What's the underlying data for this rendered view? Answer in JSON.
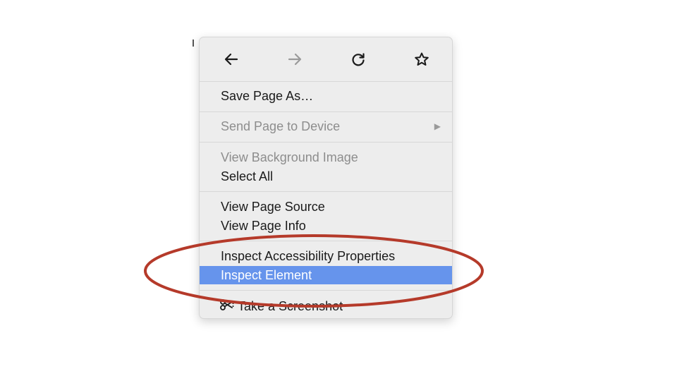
{
  "nav": {
    "back_icon": "arrow-left-icon",
    "forward_icon": "arrow-right-icon",
    "reload_icon": "reload-icon",
    "bookmark_icon": "star-icon"
  },
  "menu": {
    "save_page_as": "Save Page As…",
    "send_page_to_device": "Send Page to Device",
    "view_background_image": "View Background Image",
    "select_all": "Select All",
    "view_page_source": "View Page Source",
    "view_page_info": "View Page Info",
    "inspect_accessibility": "Inspect Accessibility Properties",
    "inspect_element": "Inspect Element",
    "take_screenshot": "Take a Screenshot",
    "screenshot_icon": "scissors-icon",
    "submenu_arrow": "▶"
  },
  "colors": {
    "menu_bg": "#ededed",
    "highlight": "#6694ec",
    "annotation_ring": "#b53a2a",
    "disabled_text": "#8d8d8d"
  }
}
